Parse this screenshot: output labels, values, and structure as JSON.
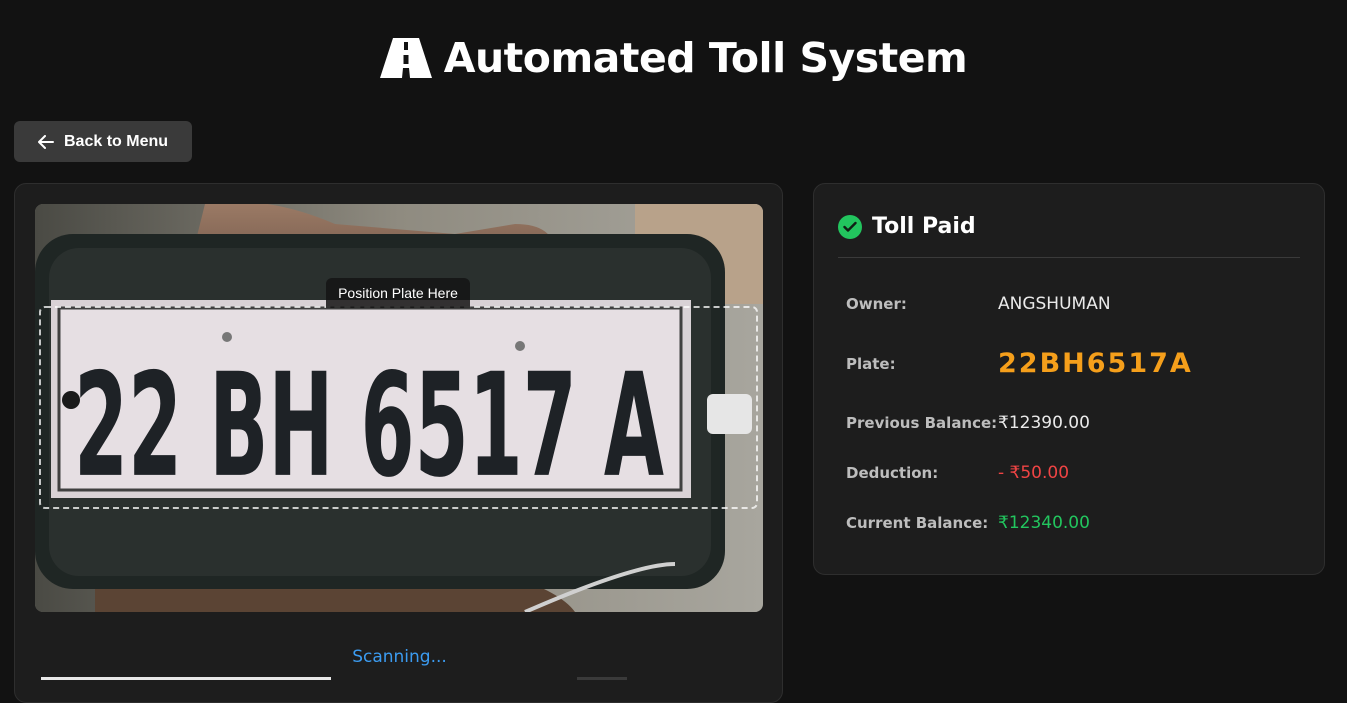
{
  "header": {
    "title": "Automated Toll System",
    "icon": "road-icon"
  },
  "back_button": {
    "label": "Back to Menu",
    "icon": "arrow-left-icon"
  },
  "scanner": {
    "guide_label": "Position Plate Here",
    "status": "Scanning...",
    "camera_plate_text": "22 BH 6517 A"
  },
  "result": {
    "title": "Toll Paid",
    "status_icon": "check-circle-icon",
    "owner_label": "Owner:",
    "owner_value": "ANGSHUMAN",
    "plate_label": "Plate:",
    "plate_value": "22BH6517A",
    "prev_label": "Previous Balance:",
    "prev_value": "₹12390.00",
    "deduction_label": "Deduction:",
    "deduction_value": "- ₹50.00",
    "current_label": "Current Balance:",
    "current_value": "₹12340.00"
  },
  "colors": {
    "background": "#121212",
    "card": "#1d1d1d",
    "accent_orange": "#f59f1b",
    "success_green": "#22c55e",
    "danger_red": "#ef4444",
    "status_blue": "#3b9bf0"
  }
}
